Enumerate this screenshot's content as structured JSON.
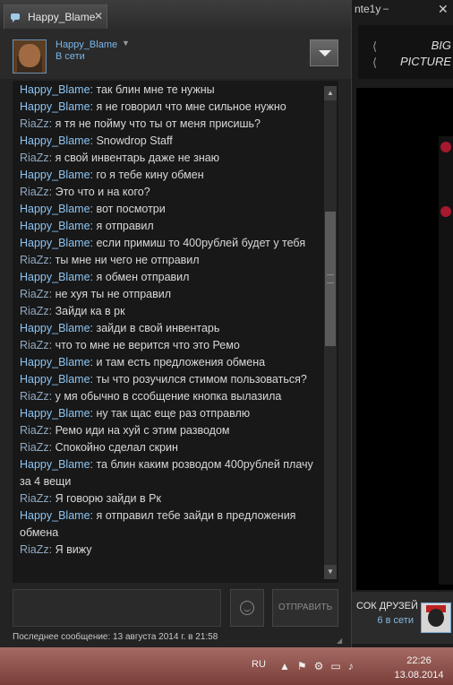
{
  "background_window": {
    "title_fragment": "nte1y",
    "minimize": "–",
    "close": "✕",
    "big_picture": {
      "line1": "BIG",
      "line2": "PICTURE"
    },
    "friends": {
      "label": "СОК ДРУЗЕЙ",
      "count": "6 в сети"
    }
  },
  "chat_window": {
    "tab": {
      "title": "Happy_Blame",
      "close": "✕"
    },
    "header": {
      "name": "Happy_Blame",
      "status": "В сети"
    },
    "messages": [
      {
        "sender": "Happy_Blame",
        "text": "так блин мне те нужны"
      },
      {
        "sender": "Happy_Blame",
        "text": "я не говорил что мне сильное нужно"
      },
      {
        "sender": "RiaZz",
        "text": "я тя не пойму что ты от меня присишь?"
      },
      {
        "sender": "Happy_Blame",
        "text": "Snowdrop Staff"
      },
      {
        "sender": "RiaZz",
        "text": "я свой инвентарь даже не знаю"
      },
      {
        "sender": "Happy_Blame",
        "text": "го я тебе кину обмен"
      },
      {
        "sender": "RiaZz",
        "text": "Это что и на кого?"
      },
      {
        "sender": "Happy_Blame",
        "text": "вот посмотри"
      },
      {
        "sender": "Happy_Blame",
        "text": "я отправил"
      },
      {
        "sender": "Happy_Blame",
        "text": "если примиш то 400рублей будет у тебя"
      },
      {
        "sender": "RiaZz",
        "text": "ты мне ни чего не отправил"
      },
      {
        "sender": "Happy_Blame",
        "text": "я обмен отправил"
      },
      {
        "sender": "RiaZz",
        "text": "не хуя ты не отправил"
      },
      {
        "sender": "RiaZz",
        "text": "Зайди ка в рк"
      },
      {
        "sender": "Happy_Blame",
        "text": "зайди в свой инвентарь"
      },
      {
        "sender": "RiaZz",
        "text": "что то мне не верится что это Ремо"
      },
      {
        "sender": "Happy_Blame",
        "text": "и там есть предложения обмена"
      },
      {
        "sender": "Happy_Blame",
        "text": "ты  что розучился стимом пользоваться?"
      },
      {
        "sender": "RiaZz",
        "text": "у мя обычно в ссобщение кнопка вылазила"
      },
      {
        "sender": "Happy_Blame",
        "text": "ну так  щас еще раз отправлю"
      },
      {
        "sender": "RiaZz",
        "text": "Ремо иди на хуй с этим разводом"
      },
      {
        "sender": "RiaZz",
        "text": "Спокойно сделал скрин"
      },
      {
        "sender": "Happy_Blame",
        "text": "та блин каким розводом 400рублей плачу за 4 вещи"
      },
      {
        "sender": "RiaZz",
        "text": "Я говорю зайди в Рк"
      },
      {
        "sender": "Happy_Blame",
        "text": "я отправил тебе зайди в предложения обмена"
      },
      {
        "sender": "RiaZz",
        "text": "Я вижу"
      }
    ],
    "send_label": "ОТПРАВИТЬ",
    "last_message": "Последнее сообщение: 13 августа 2014 г. в 21:58",
    "colors": {
      "happy_blame": "#8cc4f2",
      "riazz": "#8fa9c2",
      "text": "#d8d8d8"
    }
  },
  "taskbar": {
    "language": "RU",
    "time": "22:26",
    "date": "13.08.2014"
  }
}
